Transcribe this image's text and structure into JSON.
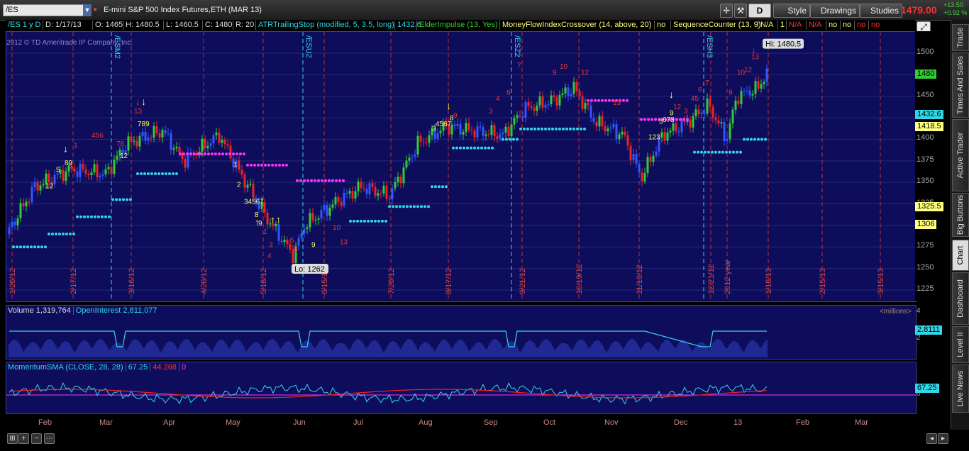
{
  "toolbar": {
    "symbol": "/ES",
    "title": "E-mini S&P 500 Index Futures,ETH (MAR 13)",
    "d_button": "D",
    "style_label": "Style",
    "drawings_label": "Drawings",
    "studies_label": "Studies",
    "last_price": "1479.00",
    "change_abs": "+13.50",
    "change_pct": "+0.92 %"
  },
  "studies_header": {
    "chart_id": "/ES 1 y D",
    "date": "D: 1/17/13",
    "open": "O: 1465",
    "high": "H: 1480.5",
    "low": "L: 1460.5",
    "close": "C: 1480",
    "r": "R: 20",
    "atr": "ATRTrailingStop (modified, 5, 3.5, long)",
    "atr_val": "1432.6",
    "elder": "ElderImpulse (13, Yes)",
    "mfi": "MoneyFlowIndexCrossover (14, above, 20)",
    "mfi_val": "no",
    "seq": "SequenceCounter (13, 9)",
    "seq_vals": [
      "N/A",
      "1",
      "N/A",
      "N/A",
      "no",
      "no",
      "no",
      "no"
    ]
  },
  "chart": {
    "copyright": "2012 © TD Ameritrade IP Company, Inc.",
    "contract_labels": [
      "/ESM2",
      "/ESU2",
      "/ESZ2",
      "/ESH3"
    ],
    "date_labels": [
      "1/20/12",
      "2/17/12",
      "3/16/12",
      "4/20/12",
      "5/18/12",
      "6/15/12",
      "7/20/12",
      "8/17/12",
      "9/21/12",
      "10/19/12",
      "11/16/12",
      "12/21/12",
      "2012 year",
      "1/18/13",
      "2/15/13",
      "3/15/13"
    ],
    "hi_bubble": "Hi: 1480.5",
    "lo_bubble": "Lo: 1262"
  },
  "price_axis": {
    "ticks": [
      "1500",
      "1475",
      "1450",
      "1425",
      "1400",
      "1375",
      "1350",
      "1325",
      "1300",
      "1275",
      "1250",
      "1225"
    ],
    "labels": [
      {
        "text": "1480",
        "color": "#33cc33"
      },
      {
        "text": "1432.6",
        "color": "#33d6e6"
      },
      {
        "text": "1418.5",
        "color": "#ffff80"
      },
      {
        "text": "1325.5",
        "color": "#ffff80"
      },
      {
        "text": "1306",
        "color": "#ffff80"
      }
    ]
  },
  "volume": {
    "label": "Volume",
    "value": "1,319,764",
    "oi_label": "OpenInterest",
    "oi_value": "2,811,077",
    "units": "<millions>",
    "axis": [
      "4",
      "2"
    ],
    "oi_badge": "2.8111"
  },
  "momentum": {
    "label": "MomentumSMA (CLOSE, 28, 28)",
    "v1": "67.25",
    "v2": "44.268",
    "v3": "0",
    "badge": "67.25",
    "axis0": "0"
  },
  "x_axis": [
    "Feb",
    "Mar",
    "Apr",
    "May",
    "Jun",
    "Jul",
    "Aug",
    "Sep",
    "Oct",
    "Nov",
    "Dec",
    "13",
    "Feb",
    "Mar"
  ],
  "sidebar": [
    "Trade",
    "Times And Sales",
    "Active Trader",
    "Big Buttons",
    "Chart",
    "Dashboard",
    "Level II",
    "Live News"
  ],
  "colors": {
    "panel": "#0d0d5c",
    "up": "#33cc33",
    "down": "#ee2222",
    "trail": "#33d6e6",
    "magenta": "#ff33ff"
  }
}
